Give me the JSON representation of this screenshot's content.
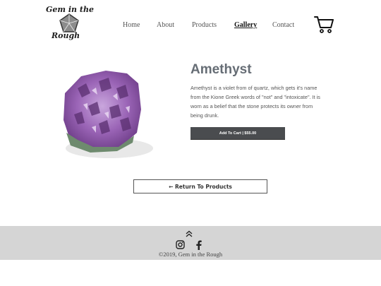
{
  "logo": {
    "line1": "Gem in the",
    "line2": "Rough"
  },
  "nav": [
    {
      "label": "Home"
    },
    {
      "label": "About"
    },
    {
      "label": "Products"
    },
    {
      "label": "Gallery"
    },
    {
      "label": "Contact"
    }
  ],
  "active_nav": "Gallery",
  "product": {
    "title": "Amethyst",
    "description": "Amethyst is a violet from of quartz, which gets it's name from the Kione Greek words of \"not\" and \"intoxicate\". It is worn as a belief that the stone protects its owner from being drunk.",
    "add_to_cart_label": "Add To Cart | $55.00"
  },
  "return_label": "← Return To Products",
  "footer": {
    "copyright": "©2019, Gem in the Rough"
  },
  "icons": {
    "logo": "pentagon-gem-icon",
    "cart": "cart-icon",
    "back_to_top": "chevron-double-up-icon",
    "instagram": "instagram-icon",
    "facebook": "facebook-icon"
  },
  "colors": {
    "title": "#666d75",
    "button": "#4a4c4f",
    "footer_bg": "#d5d5d5",
    "gem_purple": "#8a4fa6"
  }
}
